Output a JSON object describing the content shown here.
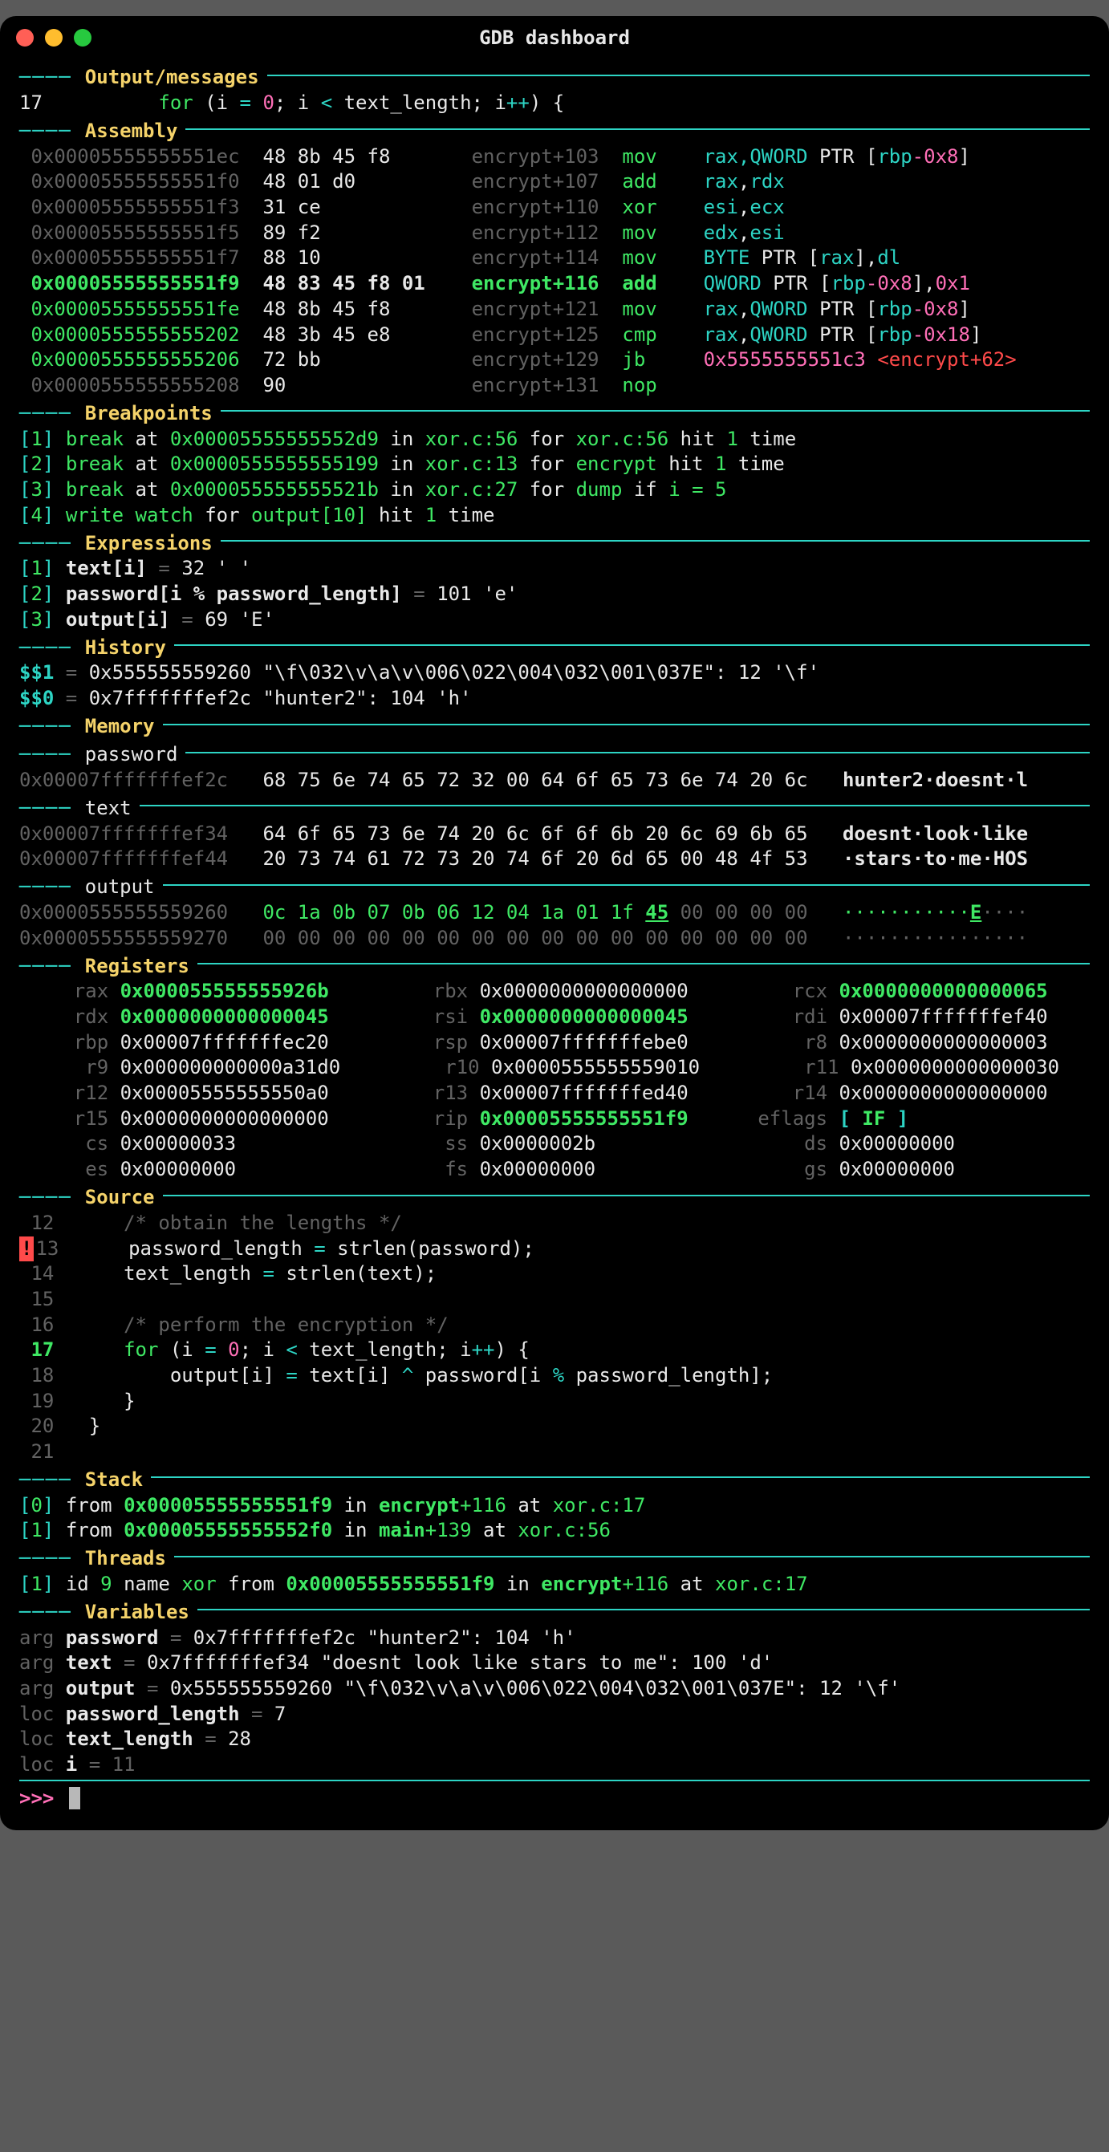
{
  "window": {
    "title": "GDB dashboard"
  },
  "sections": {
    "output": "Output/messages",
    "assembly": "Assembly",
    "breakpoints": "Breakpoints",
    "expressions": "Expressions",
    "history": "History",
    "memory": "Memory",
    "registers": "Registers",
    "source": "Source",
    "stack": "Stack",
    "threads": "Threads",
    "variables": "Variables"
  },
  "output": {
    "lineno": "17",
    "code": "for (i = 0; i < text_length; i++) {"
  },
  "assembly": [
    {
      "addr": "0x00005555555551ec",
      "bytes": "48 8b 45 f8",
      "loc": "encrypt+103",
      "op": "mov",
      "hl": false,
      "args": [
        [
          "BYTE",
          "rax,"
        ],
        [
          "CY",
          "QWORD"
        ],
        [
          "W",
          " PTR ["
        ],
        [
          "BYTE",
          "rbp"
        ],
        [
          "MG",
          "-0x8"
        ],
        [
          "W",
          "]"
        ]
      ]
    },
    {
      "addr": "0x00005555555551f0",
      "bytes": "48 01 d0",
      "loc": "encrypt+107",
      "op": "add",
      "hl": false,
      "args": [
        [
          "BYTE",
          "rax"
        ],
        [
          "W",
          ","
        ],
        [
          "BYTE",
          "rdx"
        ]
      ]
    },
    {
      "addr": "0x00005555555551f3",
      "bytes": "31 ce",
      "loc": "encrypt+110",
      "op": "xor",
      "hl": false,
      "args": [
        [
          "BYTE",
          "esi"
        ],
        [
          "W",
          ","
        ],
        [
          "BYTE",
          "ecx"
        ]
      ]
    },
    {
      "addr": "0x00005555555551f5",
      "bytes": "89 f2",
      "loc": "encrypt+112",
      "op": "mov",
      "hl": false,
      "args": [
        [
          "BYTE",
          "edx"
        ],
        [
          "W",
          ","
        ],
        [
          "BYTE",
          "esi"
        ]
      ]
    },
    {
      "addr": "0x00005555555551f7",
      "bytes": "88 10",
      "loc": "encrypt+114",
      "op": "mov",
      "hl": false,
      "args": [
        [
          "CY",
          "BYTE"
        ],
        [
          "W",
          " PTR ["
        ],
        [
          "BYTE",
          "rax"
        ],
        [
          "W",
          "],"
        ],
        [
          "BYTE",
          "dl"
        ]
      ]
    },
    {
      "addr": "0x00005555555551f9",
      "bytes": "48 83 45 f8 01",
      "loc": "encrypt+116",
      "op": "add",
      "hl": true,
      "args": [
        [
          "CY",
          "QWORD"
        ],
        [
          "W",
          " PTR ["
        ],
        [
          "BYTE",
          "rbp"
        ],
        [
          "MG",
          "-0x8"
        ],
        [
          "W",
          "],"
        ],
        [
          "MG",
          "0x1"
        ]
      ]
    },
    {
      "addr": "0x00005555555551fe",
      "bytes": "48 8b 45 f8",
      "loc": "encrypt+121",
      "op": "mov",
      "hl": false,
      "args": [
        [
          "BYTE",
          "rax"
        ],
        [
          "W",
          ","
        ],
        [
          "CY",
          "QWORD"
        ],
        [
          "W",
          " PTR ["
        ],
        [
          "BYTE",
          "rbp"
        ],
        [
          "MG",
          "-0x8"
        ],
        [
          "W",
          "]"
        ]
      ]
    },
    {
      "addr": "0x0000555555555202",
      "bytes": "48 3b 45 e8",
      "loc": "encrypt+125",
      "op": "cmp",
      "hl": false,
      "args": [
        [
          "BYTE",
          "rax"
        ],
        [
          "W",
          ","
        ],
        [
          "CY",
          "QWORD"
        ],
        [
          "W",
          " PTR ["
        ],
        [
          "BYTE",
          "rbp"
        ],
        [
          "MG",
          "-0x18"
        ],
        [
          "W",
          "]"
        ]
      ]
    },
    {
      "addr": "0x0000555555555206",
      "bytes": "72 bb",
      "loc": "encrypt+129",
      "op": "jb",
      "hl": false,
      "args": [
        [
          "MG",
          "0x5555555551c3"
        ],
        [
          "W",
          " "
        ],
        [
          "RD",
          "<encrypt+62>"
        ]
      ]
    },
    {
      "addr": "0x0000555555555208",
      "bytes": "90",
      "loc": "encrypt+131",
      "op": "nop",
      "hl": false,
      "args": []
    }
  ],
  "breakpoints": [
    {
      "idx": "1",
      "text": "break at 0x00005555555552d9 in xor.c:56 for xor.c:56 hit 1 time",
      "gr": [
        "break",
        "0x00005555555552d9",
        "xor.c:56",
        "xor.c:56",
        "1"
      ]
    },
    {
      "idx": "2",
      "text": "break at 0x0000555555555199 in xor.c:13 for encrypt hit 1 time",
      "gr": [
        "break",
        "0x0000555555555199",
        "xor.c:13",
        "encrypt",
        "1"
      ]
    },
    {
      "idx": "3",
      "text": "break at 0x000055555555521b in xor.c:27 for dump if i = 5",
      "gr": [
        "break",
        "0x000055555555521b",
        "xor.c:27",
        "dump",
        "i = 5"
      ]
    },
    {
      "idx": "4",
      "text": "write watch for output[10] hit 1 time",
      "gr": [
        "write watch",
        "output[10]",
        "1"
      ]
    }
  ],
  "expressions": [
    {
      "idx": "1",
      "expr": "text[i]",
      "val": "32 ' '"
    },
    {
      "idx": "2",
      "expr": "password[i % password_length]",
      "val": "101 'e'"
    },
    {
      "idx": "3",
      "expr": "output[i]",
      "val": "69 'E'"
    }
  ],
  "history": [
    {
      "var": "$$1",
      "val": "0x555555559260 \"\\f\\032\\v\\a\\v\\006\\022\\004\\032\\001\\037E\": 12 '\\f'"
    },
    {
      "var": "$$0",
      "val": "0x7fffffffef2c \"hunter2\": 104 'h'"
    }
  ],
  "memory": {
    "password": [
      {
        "addr": "0x00007fffffffef2c",
        "hex": "68 75 6e 74 65 72 32 00 64 6f 65 73 6e 74 20 6c",
        "ascii": "hunter2·doesnt·l"
      }
    ],
    "text": [
      {
        "addr": "0x00007fffffffef34",
        "hex": "64 6f 65 73 6e 74 20 6c 6f 6f 6b 20 6c 69 6b 65",
        "ascii": "doesnt·look·like"
      },
      {
        "addr": "0x00007fffffffef44",
        "hex": "20 73 74 61 72 73 20 74 6f 20 6d 65 00 48 4f 53",
        "ascii": "·stars·to·me·HOS"
      }
    ],
    "output": [
      {
        "addr": "0x0000555555559260",
        "hex": "0c 1a 0b 07 0b 06 12 04 1a 01 1f ",
        "hexhl": "45",
        "hextail": " 00 00 00 00",
        "ascii": "···········",
        "asciihl": "E",
        "asciitail": "····"
      },
      {
        "addr": "0x0000555555559270",
        "hex": "00 00 00 00 00 00 00 00 00 00 00 00 00 00 00 00",
        "ascii": "················"
      }
    ]
  },
  "registers": [
    [
      {
        "n": "rax",
        "v": "0x000055555555926b",
        "hl": true
      },
      {
        "n": "rbx",
        "v": "0x0000000000000000"
      },
      {
        "n": "rcx",
        "v": "0x0000000000000065",
        "hl": true
      }
    ],
    [
      {
        "n": "rdx",
        "v": "0x0000000000000045",
        "hl": true
      },
      {
        "n": "rsi",
        "v": "0x0000000000000045",
        "hl": true
      },
      {
        "n": "rdi",
        "v": "0x00007fffffffef40"
      }
    ],
    [
      {
        "n": "rbp",
        "v": "0x00007fffffffec20"
      },
      {
        "n": "rsp",
        "v": "0x00007fffffffebe0"
      },
      {
        "n": "r8",
        "v": "0x0000000000000003"
      }
    ],
    [
      {
        "n": "r9",
        "v": "0x000000000000a31d0"
      },
      {
        "n": "r10",
        "v": "0x0000555555559010"
      },
      {
        "n": "r11",
        "v": "0x0000000000000030"
      }
    ],
    [
      {
        "n": "r12",
        "v": "0x00005555555550a0"
      },
      {
        "n": "r13",
        "v": "0x00007fffffffed40"
      },
      {
        "n": "r14",
        "v": "0x0000000000000000"
      }
    ],
    [
      {
        "n": "r15",
        "v": "0x0000000000000000"
      },
      {
        "n": "rip",
        "v": "0x00005555555551f9",
        "hl": true
      },
      {
        "n": "eflags",
        "v": "[ IF ]",
        "flag": true
      }
    ],
    [
      {
        "n": "cs",
        "v": "0x00000033"
      },
      {
        "n": "ss",
        "v": "0x0000002b"
      },
      {
        "n": "ds",
        "v": "0x00000000"
      }
    ],
    [
      {
        "n": "es",
        "v": "0x00000000"
      },
      {
        "n": "fs",
        "v": "0x00000000"
      },
      {
        "n": "gs",
        "v": "0x00000000"
      }
    ]
  ],
  "source": [
    {
      "ln": "12",
      "text": "/* obtain the lengths */",
      "comment": true
    },
    {
      "ln": "13",
      "text": "password_length = strlen(password);",
      "bp": true
    },
    {
      "ln": "14",
      "text": "text_length = strlen(text);"
    },
    {
      "ln": "15",
      "text": ""
    },
    {
      "ln": "16",
      "text": "/* perform the encryption */",
      "comment": true
    },
    {
      "ln": "17",
      "text": "for (i = 0; i < text_length; i++) {",
      "cur": true
    },
    {
      "ln": "18",
      "text": "    output[i] = text[i] ^ password[i % password_length];"
    },
    {
      "ln": "19",
      "text": "}"
    },
    {
      "ln": "20",
      "text": "}",
      "dedent": true
    },
    {
      "ln": "21",
      "text": ""
    }
  ],
  "stack": [
    {
      "idx": "0",
      "addr": "0x00005555555551f9",
      "fn": "encrypt",
      "off": "+116",
      "loc": "xor.c:17"
    },
    {
      "idx": "1",
      "addr": "0x00005555555552f0",
      "fn": "main",
      "off": "+139",
      "loc": "xor.c:56"
    }
  ],
  "threads": [
    {
      "idx": "1",
      "id": "9",
      "name": "xor",
      "addr": "0x00005555555551f9",
      "fn": "encrypt",
      "off": "+116",
      "loc": "xor.c:17"
    }
  ],
  "variables": [
    {
      "kind": "arg",
      "name": "password",
      "val": "0x7fffffffef2c \"hunter2\": 104 'h'"
    },
    {
      "kind": "arg",
      "name": "text",
      "val": "0x7fffffffef34 \"doesnt look like stars to me\": 100 'd'"
    },
    {
      "kind": "arg",
      "name": "output",
      "val": "0x555555559260 \"\\f\\032\\v\\a\\v\\006\\022\\004\\032\\001\\037E\": 12 '\\f'"
    },
    {
      "kind": "loc",
      "name": "password_length",
      "val": "7"
    },
    {
      "kind": "loc",
      "name": "text_length",
      "val": "28"
    },
    {
      "kind": "loc",
      "name": "i",
      "val": "11",
      "dimval": true
    }
  ],
  "prompt": ">>>"
}
